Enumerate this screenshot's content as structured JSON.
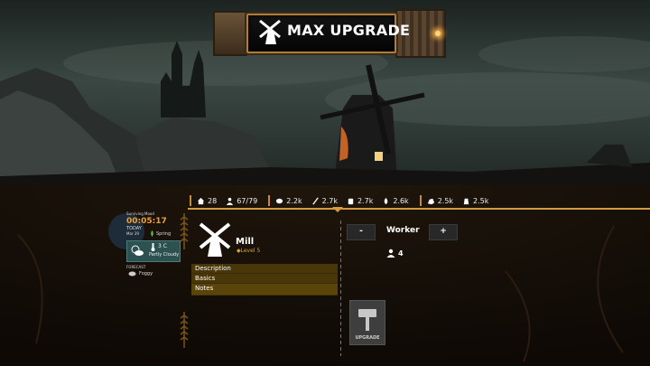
{
  "banner": {
    "title": "MAX UPGRADE",
    "icon": "windmill-icon"
  },
  "resources": [
    {
      "icon": "house-icon",
      "value": "28"
    },
    {
      "icon": "person-icon",
      "value": "67/79"
    },
    {
      "icon": "wood-icon",
      "value": "2.2k"
    },
    {
      "icon": "wheat-icon",
      "value": "2.7k"
    },
    {
      "icon": "flour-icon",
      "value": "2.7k"
    },
    {
      "icon": "water-icon",
      "value": "2.6k"
    },
    {
      "icon": "stone-icon",
      "value": "2.5k"
    },
    {
      "icon": "grain-sack-icon",
      "value": "2.5k"
    }
  ],
  "clock": {
    "label": "Surviving Mood",
    "time": "00:05:17",
    "today_label": "TODAY",
    "date": "Mar 29",
    "season": "Spring",
    "temperature": "3 C",
    "condition": "Partly Cloudy",
    "forecast_label": "FORECAST",
    "forecast": "Foggy"
  },
  "building": {
    "name": "Mill",
    "level": "Level 5",
    "tabs": [
      "Description",
      "Basics",
      "Notes"
    ]
  },
  "workers": {
    "label": "Worker",
    "minus": "-",
    "plus": "+",
    "count": "4"
  },
  "upgrade": {
    "label": "UPGRADE"
  },
  "colors": {
    "accent": "#d49a40",
    "level": "#e0a030",
    "time": "#f0a030",
    "tab_bg": "#5a440a"
  }
}
